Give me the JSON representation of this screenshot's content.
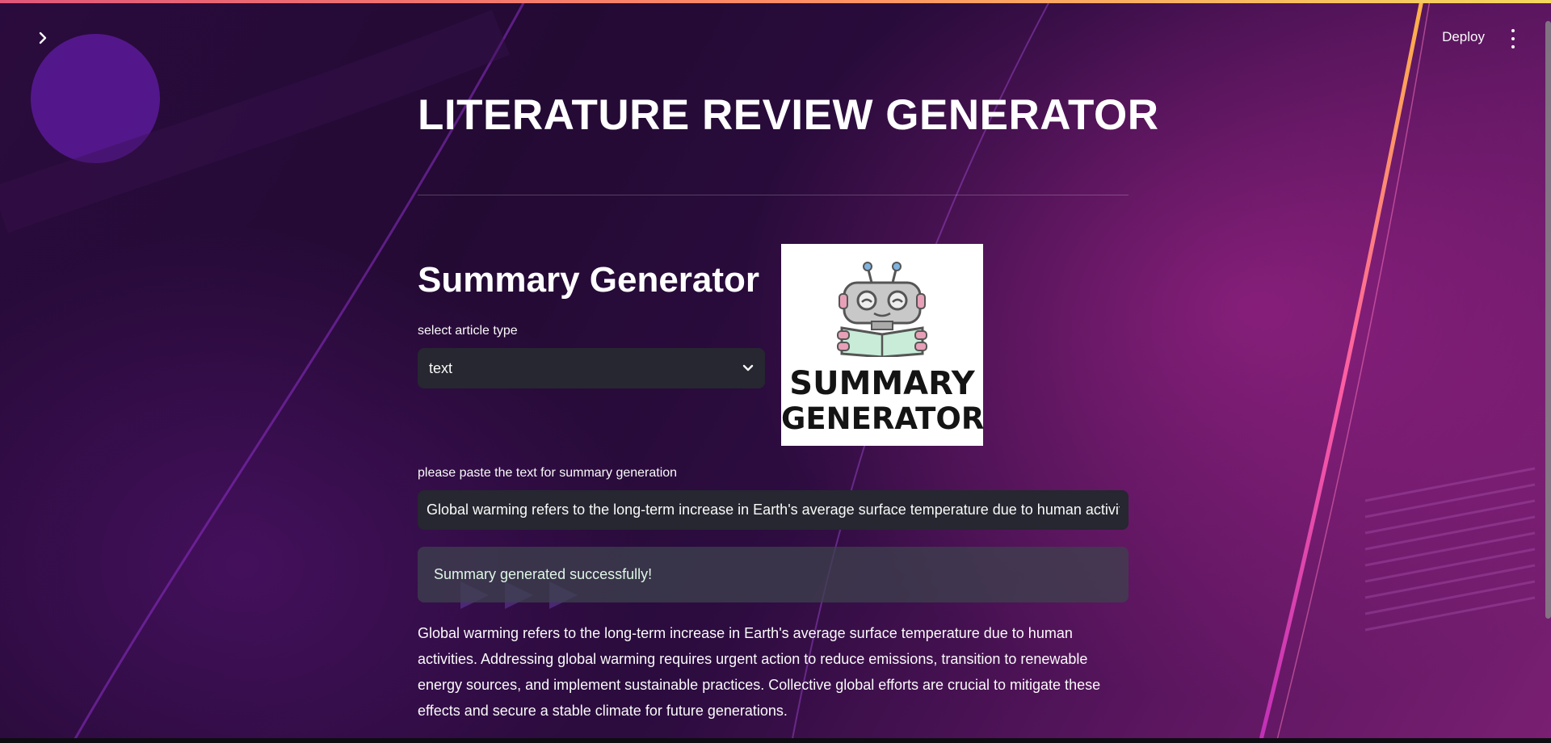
{
  "header": {
    "deploy_label": "Deploy",
    "sidebar_toggle_icon": "chevron-right-icon",
    "menu_icon": "vertical-dots-icon"
  },
  "main": {
    "title": "LITERATURE REVIEW GENERATOR",
    "section_title": "Summary Generator",
    "article_type": {
      "label": "select article type",
      "selected": "text"
    },
    "logo": {
      "line1": "SUMMARY",
      "line2": "GENERATOR"
    },
    "text_input": {
      "label": "please paste the text for summary generation",
      "value": "Global warming refers to the long-term increase in Earth's average surface temperature due to human activities."
    },
    "success_message": "Summary generated successfully!",
    "summary": "Global warming refers to the long-term increase in Earth's average surface temperature due to human activities. Addressing global warming requires urgent action to reduce emissions, transition to renewable energy sources, and implement sustainable practices. Collective global efforts are crucial to mitigate these effects and secure a stable climate for future generations."
  },
  "colors": {
    "accent_line": "#ff8c66",
    "input_bg": "#262730",
    "success_text": "#dff7e6"
  }
}
